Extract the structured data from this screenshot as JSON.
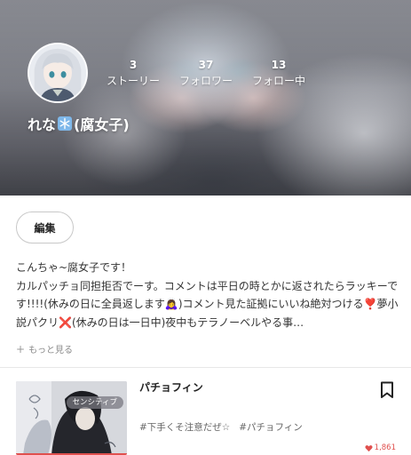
{
  "profile": {
    "name_prefix": "れな",
    "name_suffix": "(腐女子)",
    "name_icon": "snowflake-icon",
    "stats": [
      {
        "count": "3",
        "label": "ストーリー"
      },
      {
        "count": "37",
        "label": "フォロワー"
      },
      {
        "count": "13",
        "label": "フォロー中"
      }
    ],
    "edit_label": "編集",
    "bio": "こんちゃ~腐女子です！\nカルパッチョ同担拒否でーす。コメントは平日の時とかに返されたらラッキーです!!!!(休みの日に全員返します🙇‍♀️)コメント見た証拠にいいね絶対つける❣️夢小説パクリ❌(休みの日は一日中)夜中もテラノーベルやる事…",
    "more_label": "もっと見る"
  },
  "story": {
    "title": "パチョフィン",
    "badge": "センシティブ",
    "tags": [
      "#下手くそ注意だぜ☆",
      "#パチョフィン"
    ],
    "likes": "1,861"
  },
  "colors": {
    "accent_red": "#e0504e",
    "text_primary": "#222222",
    "text_muted": "#888888"
  }
}
